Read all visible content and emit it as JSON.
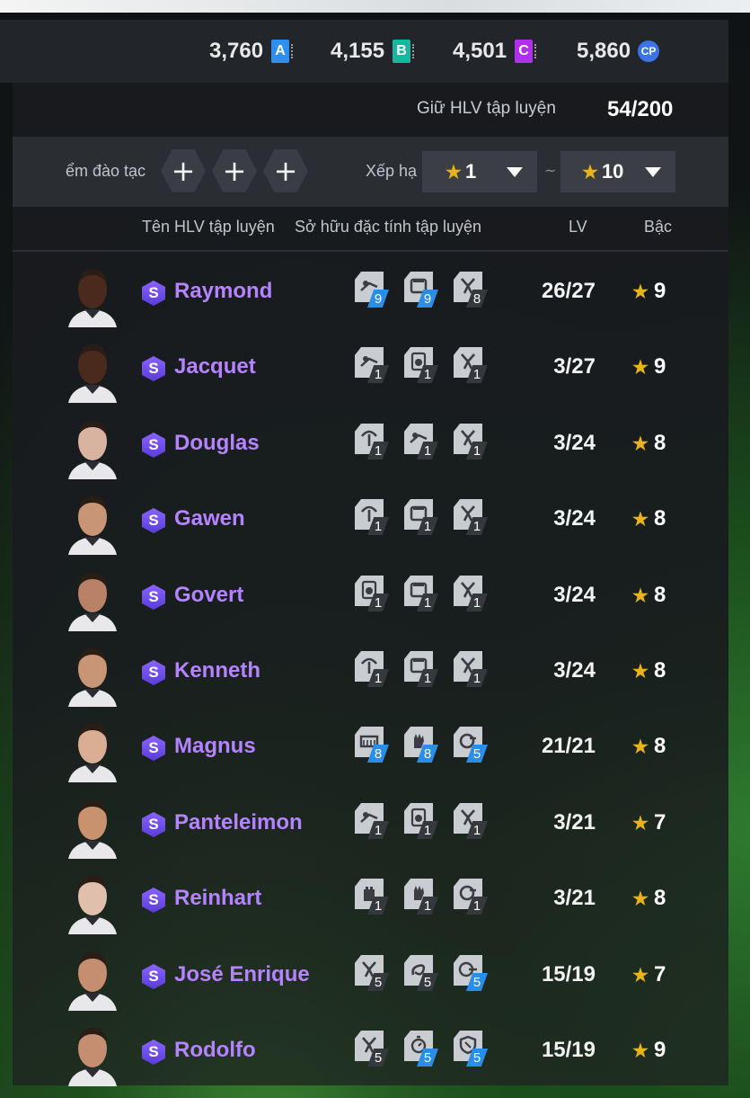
{
  "currencies": [
    {
      "amount": "3,760",
      "letter": "A",
      "color": "#2f8ff0",
      "icon": "coin-a-icon"
    },
    {
      "amount": "4,155",
      "letter": "B",
      "color": "#18b8a0",
      "icon": "coin-b-icon"
    },
    {
      "amount": "4,501",
      "letter": "C",
      "color": "#b22ef0",
      "icon": "coin-c-icon"
    },
    {
      "amount": "5,860",
      "letter": "CP",
      "color": "#3b74e6",
      "icon": "cp-icon"
    }
  ],
  "counter": {
    "label": "Giữ HLV tập luyện",
    "value": "54/200"
  },
  "filter": {
    "slot_label": "ểm đào tạc",
    "slot_button": "+",
    "rank_label": "Xếp hạ",
    "rank_from": "1",
    "rank_to": "10",
    "separator": "~",
    "star": "★"
  },
  "headers": {
    "name": "Tên HLV tập luyện",
    "traits": "Sở hữu đặc tính tập luyện",
    "lv": "LV",
    "grade": "Bậc"
  },
  "rows": [
    {
      "name": "Raymond",
      "badge": "S",
      "lv": "26/27",
      "grade": "9",
      "skin": "#4a2a1c",
      "traits": [
        {
          "icon": "pass-icon",
          "level": "9",
          "blue": true
        },
        {
          "icon": "shield-icon",
          "level": "9",
          "blue": true
        },
        {
          "icon": "tackle-icon",
          "level": "8",
          "blue": false
        }
      ]
    },
    {
      "name": "Jacquet",
      "badge": "S",
      "lv": "3/27",
      "grade": "9",
      "skin": "#4a2a1c",
      "traits": [
        {
          "icon": "pass-icon",
          "level": "1",
          "blue": false
        },
        {
          "icon": "ball-control-icon",
          "level": "1",
          "blue": false
        },
        {
          "icon": "tackle-icon",
          "level": "1",
          "blue": false
        }
      ]
    },
    {
      "name": "Douglas",
      "badge": "S",
      "lv": "3/24",
      "grade": "8",
      "skin": "#d8b4a0",
      "traits": [
        {
          "icon": "header-icon",
          "level": "1",
          "blue": false
        },
        {
          "icon": "pass-icon",
          "level": "1",
          "blue": false
        },
        {
          "icon": "tackle-icon",
          "level": "1",
          "blue": false
        }
      ]
    },
    {
      "name": "Gawen",
      "badge": "S",
      "lv": "3/24",
      "grade": "8",
      "skin": "#c89676",
      "traits": [
        {
          "icon": "header-icon",
          "level": "1",
          "blue": false
        },
        {
          "icon": "shield-icon",
          "level": "1",
          "blue": false
        },
        {
          "icon": "tackle-icon",
          "level": "1",
          "blue": false
        }
      ]
    },
    {
      "name": "Govert",
      "badge": "S",
      "lv": "3/24",
      "grade": "8",
      "skin": "#b98266",
      "traits": [
        {
          "icon": "ball-control-icon",
          "level": "1",
          "blue": false
        },
        {
          "icon": "shield-icon",
          "level": "1",
          "blue": false
        },
        {
          "icon": "tackle-icon",
          "level": "1",
          "blue": false
        }
      ]
    },
    {
      "name": "Kenneth",
      "badge": "S",
      "lv": "3/24",
      "grade": "8",
      "skin": "#c89676",
      "traits": [
        {
          "icon": "header-icon",
          "level": "1",
          "blue": false
        },
        {
          "icon": "shield-icon",
          "level": "1",
          "blue": false
        },
        {
          "icon": "tackle-icon",
          "level": "1",
          "blue": false
        }
      ]
    },
    {
      "name": "Magnus",
      "badge": "S",
      "lv": "21/21",
      "grade": "8",
      "skin": "#d9ae92",
      "traits": [
        {
          "icon": "goal-icon",
          "level": "8",
          "blue": true
        },
        {
          "icon": "glove-icon",
          "level": "8",
          "blue": true
        },
        {
          "icon": "reflex-icon",
          "level": "5",
          "blue": true
        }
      ]
    },
    {
      "name": "Panteleimon",
      "badge": "S",
      "lv": "3/21",
      "grade": "7",
      "skin": "#c8926e",
      "traits": [
        {
          "icon": "pass-icon",
          "level": "1",
          "blue": false
        },
        {
          "icon": "ball-control-icon",
          "level": "1",
          "blue": false
        },
        {
          "icon": "tackle-icon",
          "level": "1",
          "blue": false
        }
      ]
    },
    {
      "name": "Reinhart",
      "badge": "S",
      "lv": "3/21",
      "grade": "8",
      "skin": "#e0c0ac",
      "traits": [
        {
          "icon": "tower-icon",
          "level": "1",
          "blue": false
        },
        {
          "icon": "glove-icon",
          "level": "1",
          "blue": false
        },
        {
          "icon": "reflex-icon",
          "level": "1",
          "blue": false
        }
      ]
    },
    {
      "name": "José Enrique",
      "badge": "S",
      "lv": "15/19",
      "grade": "7",
      "skin": "#c58e70",
      "traits": [
        {
          "icon": "tackle-icon",
          "level": "5",
          "blue": false
        },
        {
          "icon": "dribble-icon",
          "level": "5",
          "blue": false
        },
        {
          "icon": "shot-icon",
          "level": "5",
          "blue": true
        }
      ]
    },
    {
      "name": "Rodolfo",
      "badge": "S",
      "lv": "15/19",
      "grade": "9",
      "skin": "#c58e70",
      "traits": [
        {
          "icon": "tackle-icon",
          "level": "5",
          "blue": false
        },
        {
          "icon": "stopwatch-icon",
          "level": "5",
          "blue": true
        },
        {
          "icon": "defense-icon",
          "level": "5",
          "blue": true
        }
      ]
    }
  ]
}
